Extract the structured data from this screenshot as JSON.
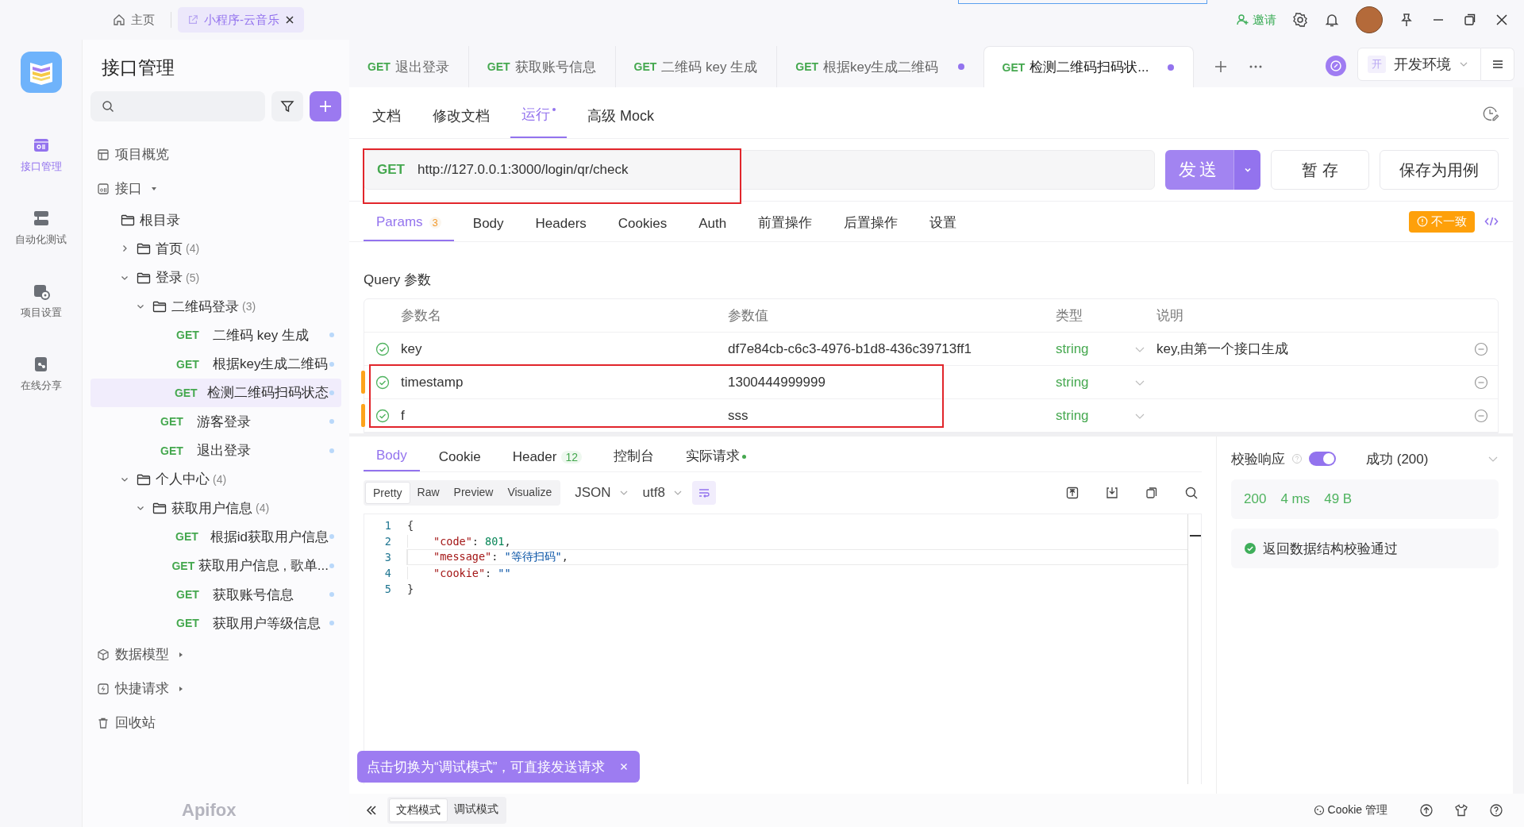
{
  "titlebar": {
    "tabs": [
      {
        "kind": "home",
        "label": "主页",
        "selected": false
      },
      {
        "kind": "project",
        "label": "小程序-云音乐",
        "selected": true
      }
    ],
    "invite": "邀请"
  },
  "nav": [
    {
      "kind": "api",
      "label": "接口管理",
      "selected": true
    },
    {
      "kind": "auto",
      "label": "自动化测试",
      "selected": false
    },
    {
      "kind": "settings",
      "label": "项目设置",
      "selected": false
    },
    {
      "kind": "share",
      "label": "在线分享",
      "selected": false
    }
  ],
  "brand": "Apifox",
  "sidebar": {
    "title": "接口管理",
    "sections": [
      {
        "kind": "overview",
        "label": "项目概览"
      },
      {
        "kind": "apis",
        "label": "接口",
        "expanded": true,
        "children": [
          {
            "kind": "root",
            "label": "根目录",
            "children": [
              {
                "kind": "folder",
                "label": "首页",
                "count": "(4)",
                "expanded": false
              },
              {
                "kind": "folder",
                "label": "登录",
                "count": "(5)",
                "expanded": true,
                "children": [
                  {
                    "kind": "folder",
                    "label": "二维码登录",
                    "count": "(3)",
                    "expanded": true,
                    "children": [
                      {
                        "kind": "request",
                        "method": "GET",
                        "label": "二维码 key 生成",
                        "selected": false
                      },
                      {
                        "kind": "request",
                        "method": "GET",
                        "label": "根据key生成二维码",
                        "selected": false
                      },
                      {
                        "kind": "request",
                        "method": "GET",
                        "label": "检测二维码扫码状态",
                        "selected": true
                      }
                    ]
                  },
                  {
                    "kind": "request",
                    "method": "GET",
                    "label": "游客登录",
                    "selected": false
                  },
                  {
                    "kind": "request",
                    "method": "GET",
                    "label": "退出登录",
                    "selected": false
                  }
                ]
              },
              {
                "kind": "folder",
                "label": "个人中心",
                "count": "(4)",
                "expanded": true,
                "children": [
                  {
                    "kind": "folder",
                    "label": "获取用户信息",
                    "count": "(4)",
                    "expanded": true,
                    "children": [
                      {
                        "kind": "request",
                        "method": "GET",
                        "label": "根据id获取用户信息",
                        "selected": false
                      },
                      {
                        "kind": "request",
                        "method": "GET",
                        "label": "获取用户信息 , 歌单...",
                        "selected": false
                      },
                      {
                        "kind": "request",
                        "method": "GET",
                        "label": "获取账号信息",
                        "selected": false
                      },
                      {
                        "kind": "request",
                        "method": "GET",
                        "label": "获取用户等级信息",
                        "selected": false
                      }
                    ]
                  }
                ]
              }
            ]
          }
        ]
      },
      {
        "kind": "models",
        "label": "数据模型",
        "expanded": false
      },
      {
        "kind": "quick",
        "label": "快捷请求",
        "expanded": false
      },
      {
        "kind": "trash",
        "label": "回收站"
      }
    ]
  },
  "tabs": [
    {
      "method": "GET",
      "label": "退出登录",
      "selected": false,
      "modified": false
    },
    {
      "method": "GET",
      "label": "获取账号信息",
      "selected": false,
      "modified": false
    },
    {
      "method": "GET",
      "label": "二维码 key 生成",
      "selected": false,
      "modified": false
    },
    {
      "method": "GET",
      "label": "根据key生成二维码",
      "selected": false,
      "modified": true
    },
    {
      "method": "GET",
      "label": "检测二维码扫码状...",
      "selected": true,
      "modified": true
    }
  ],
  "environment": {
    "badge": "开",
    "label": "开发环境"
  },
  "doc_tabs": [
    {
      "label": "文档",
      "selected": false,
      "modified": false
    },
    {
      "label": "修改文档",
      "selected": false,
      "modified": false
    },
    {
      "label": "运行",
      "selected": true,
      "modified": true
    },
    {
      "label": "高级 Mock",
      "selected": false,
      "modified": false
    }
  ],
  "request": {
    "method": "GET",
    "url": "http://127.0.0.1:3000/login/qr/check",
    "send": "发送",
    "save": "暂 存",
    "save_case": "保存为用例"
  },
  "param_tabs": [
    {
      "label": "Params",
      "count": "3",
      "selected": true
    },
    {
      "label": "Body",
      "selected": false
    },
    {
      "label": "Headers",
      "selected": false
    },
    {
      "label": "Cookies",
      "selected": false
    },
    {
      "label": "Auth",
      "selected": false
    },
    {
      "label": "前置操作",
      "selected": false
    },
    {
      "label": "后置操作",
      "selected": false
    },
    {
      "label": "设置",
      "selected": false
    }
  ],
  "mismatch_badge": "不一致",
  "query": {
    "title": "Query 参数",
    "columns": [
      "参数名",
      "参数值",
      "类型",
      "说明"
    ],
    "rows": [
      {
        "enabled": true,
        "modified": false,
        "name": "key",
        "value": "df7e84cb-c6c3-4976-b1d8-436c39713ff1",
        "type": "string",
        "description": "key,由第一个接口生成"
      },
      {
        "enabled": true,
        "modified": true,
        "name": "timestamp",
        "value": "1300444999999",
        "type": "string"
      },
      {
        "enabled": true,
        "modified": true,
        "name": "f",
        "value": "sss",
        "type": "string"
      }
    ]
  },
  "response": {
    "tabs": [
      {
        "label": "Body",
        "selected": true
      },
      {
        "label": "Cookie",
        "selected": false
      },
      {
        "label": "Header",
        "count": "12",
        "selected": false
      },
      {
        "label": "控制台",
        "selected": false
      },
      {
        "label": "实际请求",
        "selected": false,
        "dot": true
      }
    ],
    "formats": [
      {
        "label": "Pretty",
        "selected": true
      },
      {
        "label": "Raw",
        "selected": false
      },
      {
        "label": "Preview",
        "selected": false
      },
      {
        "label": "Visualize",
        "selected": false
      }
    ],
    "language": "JSON",
    "encoding": "utf8",
    "lines": [
      {
        "number": "1",
        "selected": false,
        "tokens": [
          {
            "kind": "punct",
            "text": "{"
          }
        ]
      },
      {
        "number": "2",
        "selected": false,
        "tokens": [
          {
            "kind": "key",
            "text": "\"code\""
          },
          {
            "kind": "punct",
            "text": ": "
          },
          {
            "kind": "number",
            "text": "801"
          },
          {
            "kind": "punct",
            "text": ","
          }
        ]
      },
      {
        "number": "3",
        "selected": true,
        "tokens": [
          {
            "kind": "key",
            "text": "\"message\""
          },
          {
            "kind": "punct",
            "text": ": "
          },
          {
            "kind": "string",
            "text": "\"等待扫码\""
          },
          {
            "kind": "punct",
            "text": ","
          }
        ]
      },
      {
        "number": "4",
        "selected": false,
        "tokens": [
          {
            "kind": "key",
            "text": "\"cookie\""
          },
          {
            "kind": "punct",
            "text": ": "
          },
          {
            "kind": "string",
            "text": "\"\""
          }
        ]
      },
      {
        "number": "5",
        "selected": false,
        "tokens": [
          {
            "kind": "punct",
            "text": "}"
          }
        ]
      }
    ]
  },
  "validation": {
    "label": "校验响应",
    "on": true,
    "result": "成功 (200)",
    "stats": [
      "200",
      "4 ms",
      "49 B"
    ],
    "message": "返回数据结构校验通过"
  },
  "tooltip": "点击切换为“调试模式”，可直接发送请求",
  "footer": {
    "modes": [
      {
        "label": "文档模式",
        "selected": true
      },
      {
        "label": "调试模式",
        "selected": false
      }
    ],
    "cookie": "Cookie 管理"
  }
}
